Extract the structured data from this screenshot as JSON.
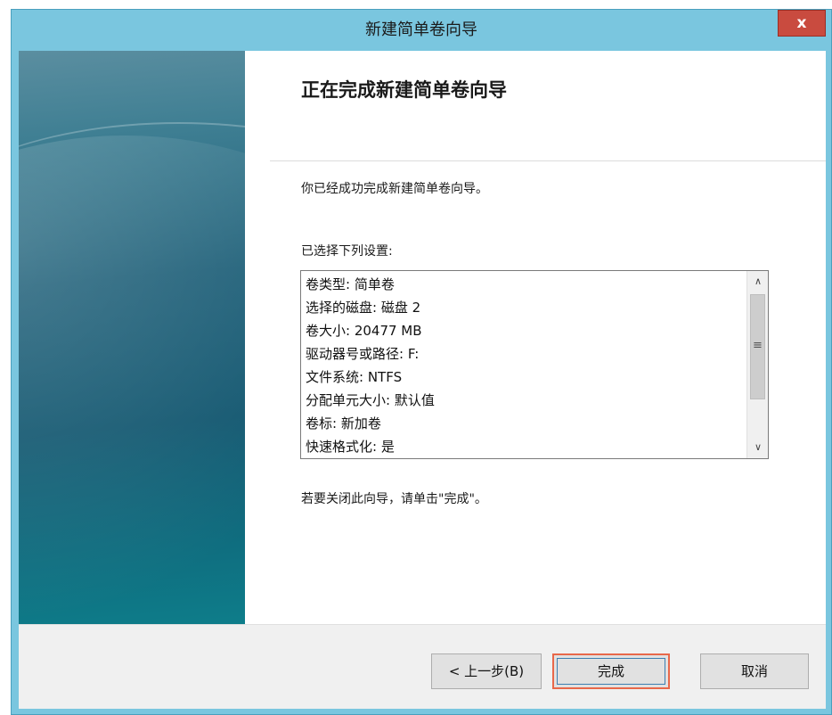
{
  "window": {
    "title": "新建简单卷向导",
    "close_label": "x"
  },
  "wizard": {
    "heading": "正在完成新建简单卷向导",
    "success_text": "你已经成功完成新建简单卷向导。",
    "settings_label": "已选择下列设置:",
    "settings": [
      "卷类型: 简单卷",
      "选择的磁盘: 磁盘 2",
      "卷大小: 20477 MB",
      "驱动器号或路径: F:",
      "文件系统: NTFS",
      "分配单元大小: 默认值",
      "卷标: 新加卷",
      "快速格式化: 是"
    ],
    "close_hint": "若要关闭此向导，请单击\"完成\"。"
  },
  "scrollbar": {
    "up_glyph": "∧",
    "down_glyph": "∨",
    "grip_glyph": "≡"
  },
  "buttons": {
    "back_label": "< 上一步(B)",
    "finish_label": "完成",
    "cancel_label": "取消"
  },
  "colors": {
    "titlebar": "#7ac6df",
    "close_button": "#c94b3f",
    "highlight": "#e8684a"
  }
}
